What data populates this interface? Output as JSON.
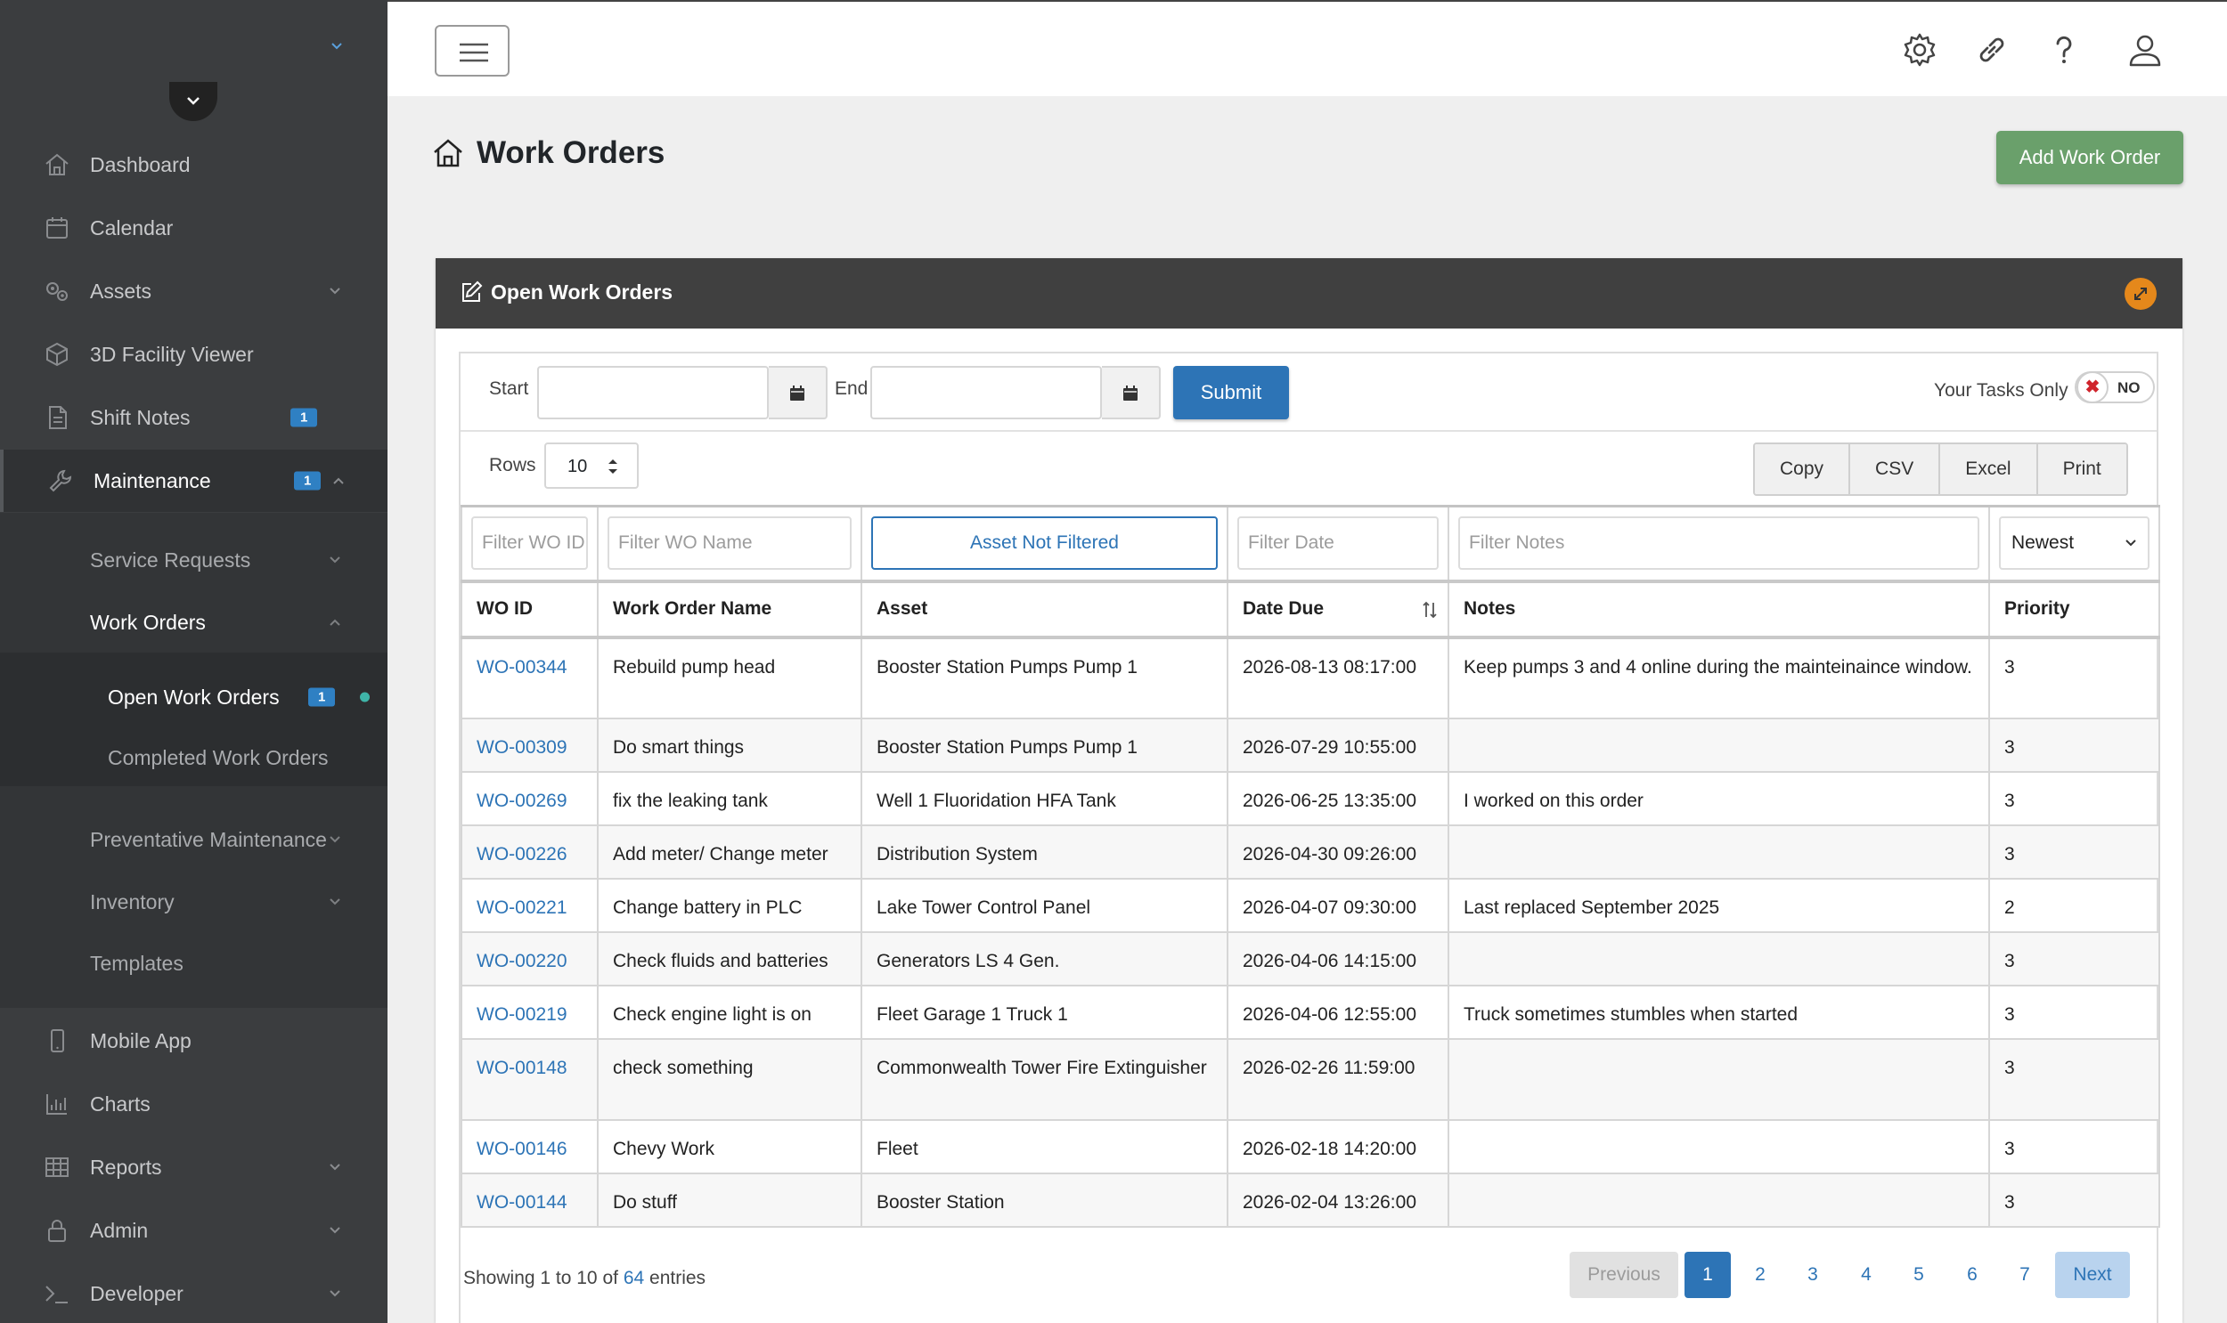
{
  "sidebar": {
    "items": [
      {
        "label": "Dashboard",
        "icon": "home-icon"
      },
      {
        "label": "Calendar",
        "icon": "calendar-icon"
      },
      {
        "label": "Assets",
        "icon": "assets-icon"
      },
      {
        "label": "3D Facility Viewer",
        "icon": "cube-icon"
      },
      {
        "label": "Shift Notes",
        "icon": "notes-icon",
        "badge": "1"
      },
      {
        "label": "Maintenance",
        "icon": "wrench-icon",
        "badge": "1"
      }
    ],
    "maintenance_sub": [
      {
        "label": "Service Requests"
      },
      {
        "label": "Work Orders"
      }
    ],
    "work_orders_sub": [
      {
        "label": "Open Work Orders",
        "badge": "1"
      },
      {
        "label": "Completed Work Orders"
      }
    ],
    "maintenance_sub2": [
      {
        "label": "Preventative Maintenance"
      },
      {
        "label": "Inventory"
      },
      {
        "label": "Templates"
      }
    ],
    "bottom_items": [
      {
        "label": "Mobile App",
        "icon": "mobile-icon"
      },
      {
        "label": "Charts",
        "icon": "chart-icon"
      },
      {
        "label": "Reports",
        "icon": "table-icon"
      },
      {
        "label": "Admin",
        "icon": "lock-icon"
      },
      {
        "label": "Developer",
        "icon": "terminal-icon"
      }
    ]
  },
  "header": {
    "title": "Work Orders",
    "add_button": "Add Work Order"
  },
  "card": {
    "title": "Open Work Orders"
  },
  "filters": {
    "start_label": "Start",
    "end_label": "End",
    "submit": "Submit",
    "your_tasks_label": "Your Tasks Only",
    "your_tasks_value": "NO",
    "rows_label": "Rows",
    "rows_value": "10",
    "export_buttons": [
      "Copy",
      "CSV",
      "Excel",
      "Print"
    ]
  },
  "table": {
    "filters": {
      "wo_id_placeholder": "Filter WO ID",
      "wo_name_placeholder": "Filter WO Name",
      "asset_button": "Asset Not Filtered",
      "date_placeholder": "Filter Date",
      "notes_placeholder": "Filter Notes",
      "sort_value": "Newest"
    },
    "columns": [
      "WO ID",
      "Work Order Name",
      "Asset",
      "Date Due",
      "Notes",
      "Priority"
    ],
    "rows": [
      {
        "id": "WO-00344",
        "name": "Rebuild pump head",
        "asset": "Booster Station Pumps Pump 1",
        "due": "2026-08-13 08:17:00",
        "notes": "Keep pumps 3 and 4 online during the mainteinaince window.",
        "priority": "3"
      },
      {
        "id": "WO-00309",
        "name": "Do smart things",
        "asset": "Booster Station Pumps Pump 1",
        "due": "2026-07-29 10:55:00",
        "notes": "",
        "priority": "3"
      },
      {
        "id": "WO-00269",
        "name": "fix the leaking tank",
        "asset": "Well 1 Fluoridation HFA Tank",
        "due": "2026-06-25 13:35:00",
        "notes": "I worked on this order",
        "priority": "3"
      },
      {
        "id": "WO-00226",
        "name": "Add meter/ Change meter",
        "asset": "Distribution System",
        "due": "2026-04-30 09:26:00",
        "notes": "",
        "priority": "3"
      },
      {
        "id": "WO-00221",
        "name": "Change battery in PLC",
        "asset": "Lake Tower Control Panel",
        "due": "2026-04-07 09:30:00",
        "notes": "Last replaced September 2025",
        "priority": "2"
      },
      {
        "id": "WO-00220",
        "name": "Check fluids and batteries",
        "asset": "Generators LS 4 Gen.",
        "due": "2026-04-06 14:15:00",
        "notes": "",
        "priority": "3"
      },
      {
        "id": "WO-00219",
        "name": "Check engine light is on",
        "asset": "Fleet Garage 1 Truck 1",
        "due": "2026-04-06 12:55:00",
        "notes": "Truck sometimes stumbles when started",
        "priority": "3"
      },
      {
        "id": "WO-00148",
        "name": "check something",
        "asset": "Commonwealth Tower Fire Extinguisher",
        "due": "2026-02-26 11:59:00",
        "notes": "",
        "priority": "3"
      },
      {
        "id": "WO-00146",
        "name": "Chevy Work",
        "asset": "Fleet",
        "due": "2026-02-18 14:20:00",
        "notes": "",
        "priority": "3"
      },
      {
        "id": "WO-00144",
        "name": "Do stuff",
        "asset": "Booster Station",
        "due": "2026-02-04 13:26:00",
        "notes": "",
        "priority": "3"
      }
    ]
  },
  "footer": {
    "info_prefix": "Showing 1 to 10 of",
    "info_total": "64",
    "info_suffix": "entries",
    "previous": "Previous",
    "next": "Next",
    "pages": [
      "1",
      "2",
      "3",
      "4",
      "5",
      "6",
      "7"
    ],
    "current_page": "1"
  },
  "colors": {
    "accent": "#2d74b6",
    "add_button": "#6aa06b",
    "sidebar_bg": "#3b3d3f",
    "card_header": "#404040",
    "expand_button": "#e5881b",
    "badge": "#2f80c3",
    "active_dot": "#3fb4a8"
  }
}
